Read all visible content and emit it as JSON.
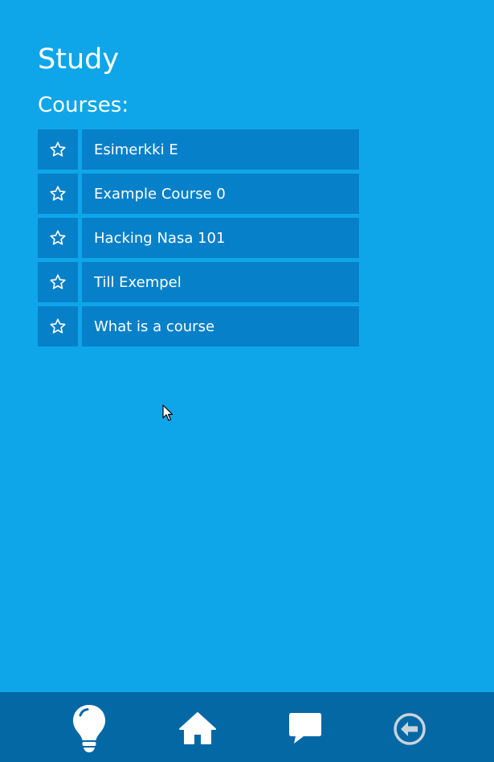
{
  "header": {
    "title": "Study",
    "section_title": "Courses:"
  },
  "courses": [
    {
      "name": "Esimerkki E",
      "icon": "star-outline-icon"
    },
    {
      "name": "Example Course 0",
      "icon": "star-outline-icon"
    },
    {
      "name": "Hacking Nasa 101",
      "icon": "star-outline-icon"
    },
    {
      "name": "Till Exempel",
      "icon": "star-outline-icon"
    },
    {
      "name": "What is a course",
      "icon": "star-outline-icon"
    }
  ],
  "bottom_nav": [
    {
      "icon": "lightbulb-icon",
      "active": true
    },
    {
      "icon": "home-icon",
      "active": false
    },
    {
      "icon": "chat-bubble-icon",
      "active": false
    },
    {
      "icon": "back-arrow-icon",
      "active": false
    }
  ],
  "colors": {
    "background": "#0fa6e9",
    "button": "#0680c8",
    "nav_bar": "#0468a5",
    "inactive_icon": "#c9d3dc"
  }
}
